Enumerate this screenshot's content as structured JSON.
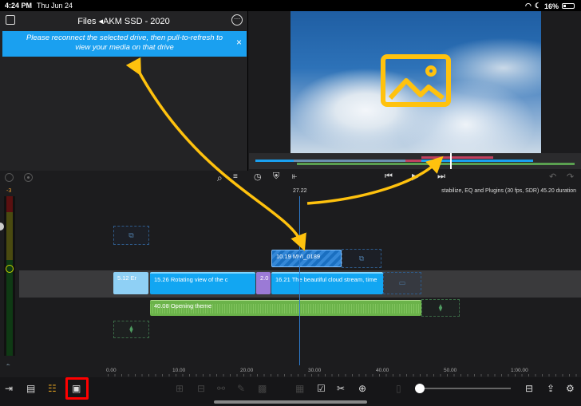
{
  "status_bar": {
    "time": "4:24 PM",
    "date": "Thu Jun 24",
    "battery": "16%"
  },
  "browser": {
    "title": "Files ◂AKM SSD - 2020",
    "banner_text": "Please reconnect the selected drive, then pull-to-refresh to view your media on that drive",
    "banner_close": "×"
  },
  "timeline": {
    "playhead_timecode": "27.22",
    "project_info": "stabilize, EQ and Plugins (30 fps, SDR)  45.20 duration",
    "meter_db": "-3",
    "clips": {
      "overlay": "10.19   MVI_0189",
      "c1": "5.12   Er",
      "c2": "15.26   Rotating view of the c",
      "c3": "2.0",
      "c4": "16.21   The beautiful cloud stream, time",
      "audio": "40.08   Opening theme"
    },
    "ruler": [
      "0.00",
      "10.00",
      "20.00",
      "30.00",
      "40.00",
      "50.00",
      "1:00.00"
    ]
  },
  "colors": {
    "accent": "#1aa0f0",
    "annotation": "#ffc20e",
    "highlight": "#ff0000",
    "audio": "#6bb34a"
  }
}
